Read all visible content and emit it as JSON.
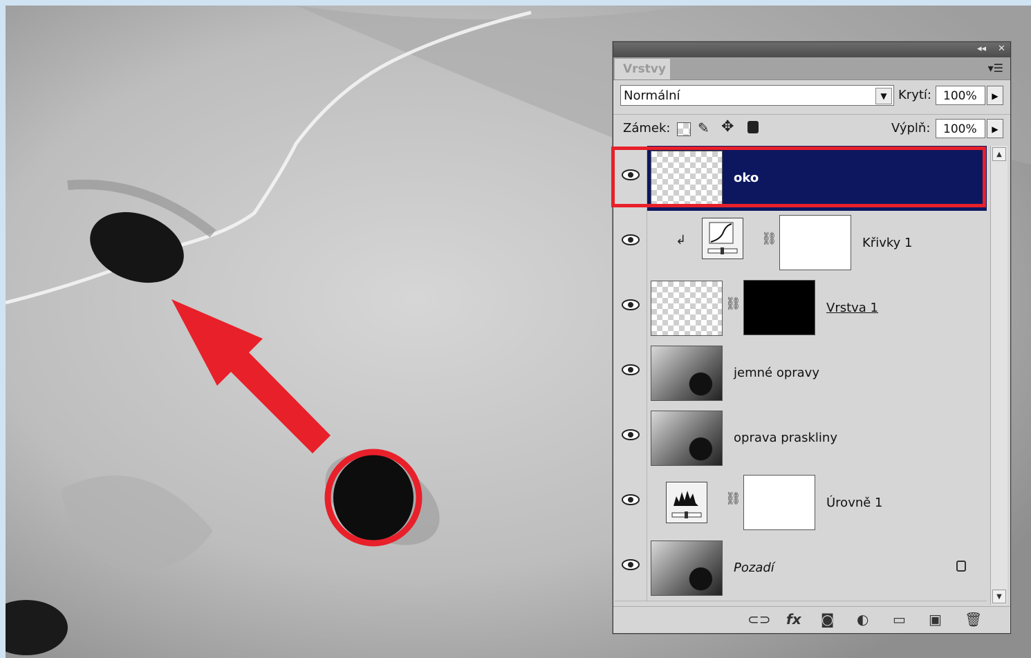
{
  "panel": {
    "title_buttons": {
      "collapse": "◂◂",
      "close": "✕"
    },
    "tab_label": "Vrstvy",
    "menu_icon": "panel-menu-icon",
    "blend_mode": "Normální",
    "opacity_label": "Krytí:",
    "opacity_value": "100%",
    "lock_label": "Zámek:",
    "fill_label": "Výplň:",
    "fill_value": "100%",
    "layers": [
      {
        "name": "oko",
        "selected": true,
        "visible": true,
        "kind": "pixel-transparent"
      },
      {
        "name": "Křivky 1",
        "selected": false,
        "visible": true,
        "kind": "adjustment-curves",
        "clipped": true
      },
      {
        "name": "Vrstva 1",
        "selected": false,
        "visible": true,
        "kind": "pixel-with-mask"
      },
      {
        "name": "jemné opravy",
        "selected": false,
        "visible": true,
        "kind": "photo"
      },
      {
        "name": "oprava praskliny",
        "selected": false,
        "visible": true,
        "kind": "photo"
      },
      {
        "name": "Úrovně 1",
        "selected": false,
        "visible": true,
        "kind": "adjustment-levels"
      },
      {
        "name": "Pozadí",
        "selected": false,
        "visible": true,
        "kind": "photo-locked"
      }
    ],
    "footer_icons": [
      "link-icon",
      "fx-icon",
      "mask-icon",
      "adjustment-icon",
      "folder-icon",
      "new-layer-icon",
      "trash-icon"
    ]
  },
  "annotation_colors": {
    "highlight": "#e8202a",
    "selected_layer": "#0d1760"
  }
}
